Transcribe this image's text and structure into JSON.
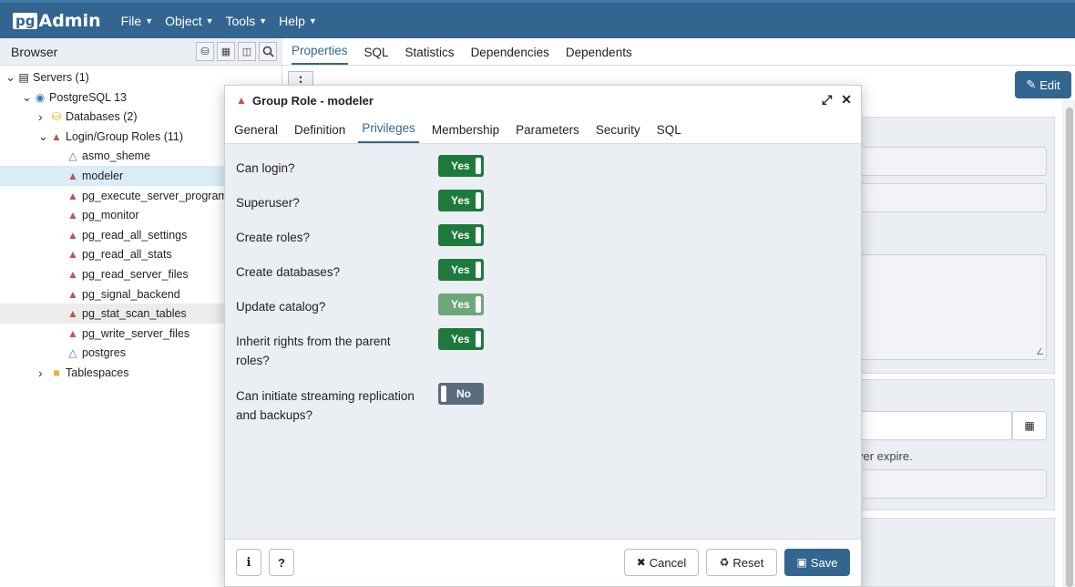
{
  "menubar": {
    "logo_pg": "pg",
    "logo_admin": "Admin",
    "items": [
      "File",
      "Object",
      "Tools",
      "Help"
    ]
  },
  "browser": {
    "title": "Browser",
    "tree": [
      {
        "label": "Servers (1)",
        "indent": 0,
        "twisty": "v",
        "icon": "servers-icon"
      },
      {
        "label": "PostgreSQL 13",
        "indent": 1,
        "twisty": "v",
        "icon": "elephant-icon"
      },
      {
        "label": "Databases (2)",
        "indent": 2,
        "twisty": ">",
        "icon": "databases-icon"
      },
      {
        "label": "Login/Group Roles (11)",
        "indent": 2,
        "twisty": "v",
        "icon": "roles-icon"
      },
      {
        "label": "asmo_sheme",
        "indent": 3,
        "twisty": "",
        "icon": "role-icon"
      },
      {
        "label": "modeler",
        "indent": 3,
        "twisty": "",
        "icon": "group-role-icon",
        "selected": true
      },
      {
        "label": "pg_execute_server_program",
        "indent": 3,
        "twisty": "",
        "icon": "group-role-icon"
      },
      {
        "label": "pg_monitor",
        "indent": 3,
        "twisty": "",
        "icon": "group-role-icon"
      },
      {
        "label": "pg_read_all_settings",
        "indent": 3,
        "twisty": "",
        "icon": "group-role-icon"
      },
      {
        "label": "pg_read_all_stats",
        "indent": 3,
        "twisty": "",
        "icon": "group-role-icon"
      },
      {
        "label": "pg_read_server_files",
        "indent": 3,
        "twisty": "",
        "icon": "group-role-icon"
      },
      {
        "label": "pg_signal_backend",
        "indent": 3,
        "twisty": "",
        "icon": "group-role-icon"
      },
      {
        "label": "pg_stat_scan_tables",
        "indent": 3,
        "twisty": "",
        "icon": "group-role-icon",
        "hover": true
      },
      {
        "label": "pg_write_server_files",
        "indent": 3,
        "twisty": "",
        "icon": "group-role-icon"
      },
      {
        "label": "postgres",
        "indent": 3,
        "twisty": "",
        "icon": "role-icon"
      },
      {
        "label": "Tablespaces",
        "indent": 2,
        "twisty": ">",
        "icon": "folder-icon"
      }
    ]
  },
  "main_tabs": [
    "Properties",
    "SQL",
    "Statistics",
    "Dependencies",
    "Dependents"
  ],
  "main_active_tab": "Properties",
  "edit_label": "Edit",
  "bg_text": "ver expire.",
  "dialog": {
    "title": "Group Role - modeler",
    "tabs": [
      "General",
      "Definition",
      "Privileges",
      "Membership",
      "Parameters",
      "Security",
      "SQL"
    ],
    "active_tab": "Privileges",
    "privileges": [
      {
        "label": "Can login?",
        "value": "Yes",
        "state": "on"
      },
      {
        "label": "Superuser?",
        "value": "Yes",
        "state": "on"
      },
      {
        "label": "Create roles?",
        "value": "Yes",
        "state": "on"
      },
      {
        "label": "Create databases?",
        "value": "Yes",
        "state": "on"
      },
      {
        "label": "Update catalog?",
        "value": "Yes",
        "state": "disabled"
      },
      {
        "label": "Inherit rights from the parent roles?",
        "value": "Yes",
        "state": "on"
      },
      {
        "label": "Can initiate streaming replication and backups?",
        "value": "No",
        "state": "off"
      }
    ],
    "footer": {
      "info": "i",
      "help": "?",
      "cancel": "Cancel",
      "reset": "Reset",
      "save": "Save"
    }
  }
}
